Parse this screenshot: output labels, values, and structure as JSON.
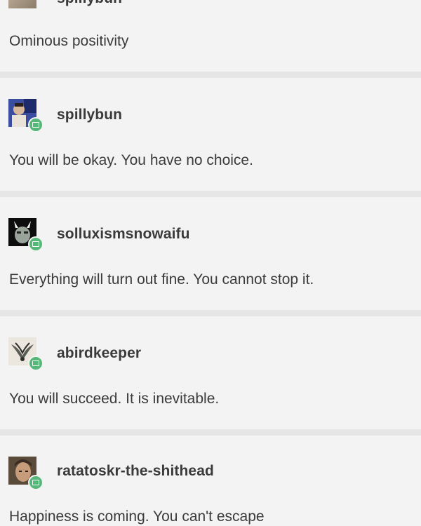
{
  "posts": [
    {
      "username": "spillybun",
      "message": "Ominous positivity",
      "avatar": "portrait-avatar"
    },
    {
      "username": "spillybun",
      "message": "You will be okay. You have no choice.",
      "avatar": "portrait-avatar"
    },
    {
      "username": "solluxismsnowaifu",
      "message": "Everything will turn out fine. You cannot stop it.",
      "avatar": "character-avatar"
    },
    {
      "username": "abirdkeeper",
      "message": "You will succeed. It is inevitable.",
      "avatar": "bird-avatar"
    },
    {
      "username": "ratatoskr-the-shithead",
      "message": "Happiness is coming. You can't escape",
      "avatar": "portrait-avatar"
    }
  ],
  "colors": {
    "background": "#f3f3f3",
    "divider": "#e6e6e6",
    "badge": "#56b778"
  }
}
